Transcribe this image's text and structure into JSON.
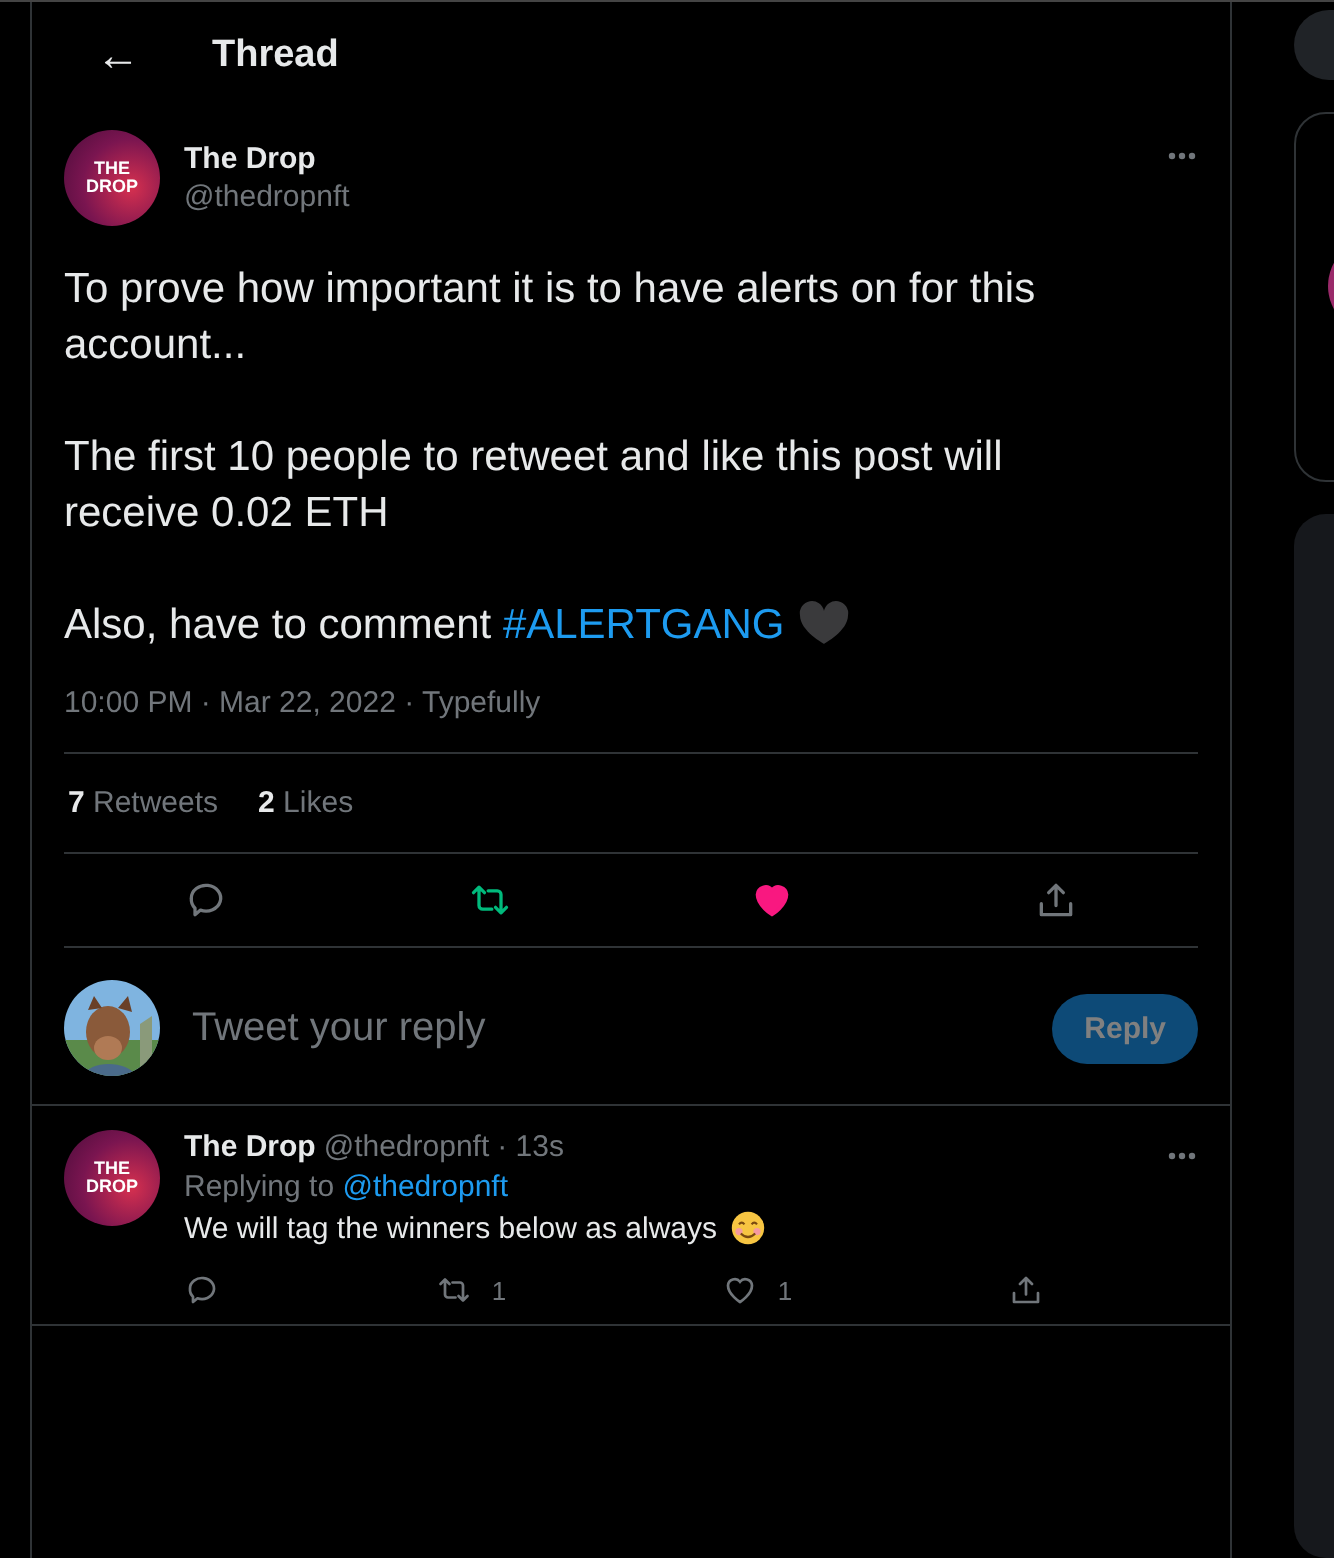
{
  "header": {
    "back_icon": "←",
    "title": "Thread"
  },
  "tweet": {
    "name": "The Drop",
    "handle": "@thedropnft",
    "avatar_text": "THE DROP",
    "paragraphs": [
      "To prove how important it is to have alerts on for this account...",
      "The first 10 people to retweet and like this post will receive 0.02 ETH",
      "Also, have to comment "
    ],
    "hashtag": "#ALERTGANG",
    "timestamp": "10:00 PM · Mar 22, 2022 · Typefully",
    "stats": [
      {
        "count": "7",
        "label": "Retweets"
      },
      {
        "count": "2",
        "label": "Likes"
      }
    ],
    "retweeted": true,
    "liked": true
  },
  "composer": {
    "placeholder": "Tweet your reply",
    "button": "Reply",
    "disabled": true
  },
  "reply": {
    "name": "The Drop",
    "handle": "@thedropnft",
    "time": "· 13s",
    "avatar_text": "THE DROP",
    "replying_prefix": "Replying to ",
    "replying_to": "@thedropnft",
    "text": "We will tag the winners below as always",
    "retweets": "1",
    "likes": "1",
    "retweeted": false,
    "liked": false
  }
}
